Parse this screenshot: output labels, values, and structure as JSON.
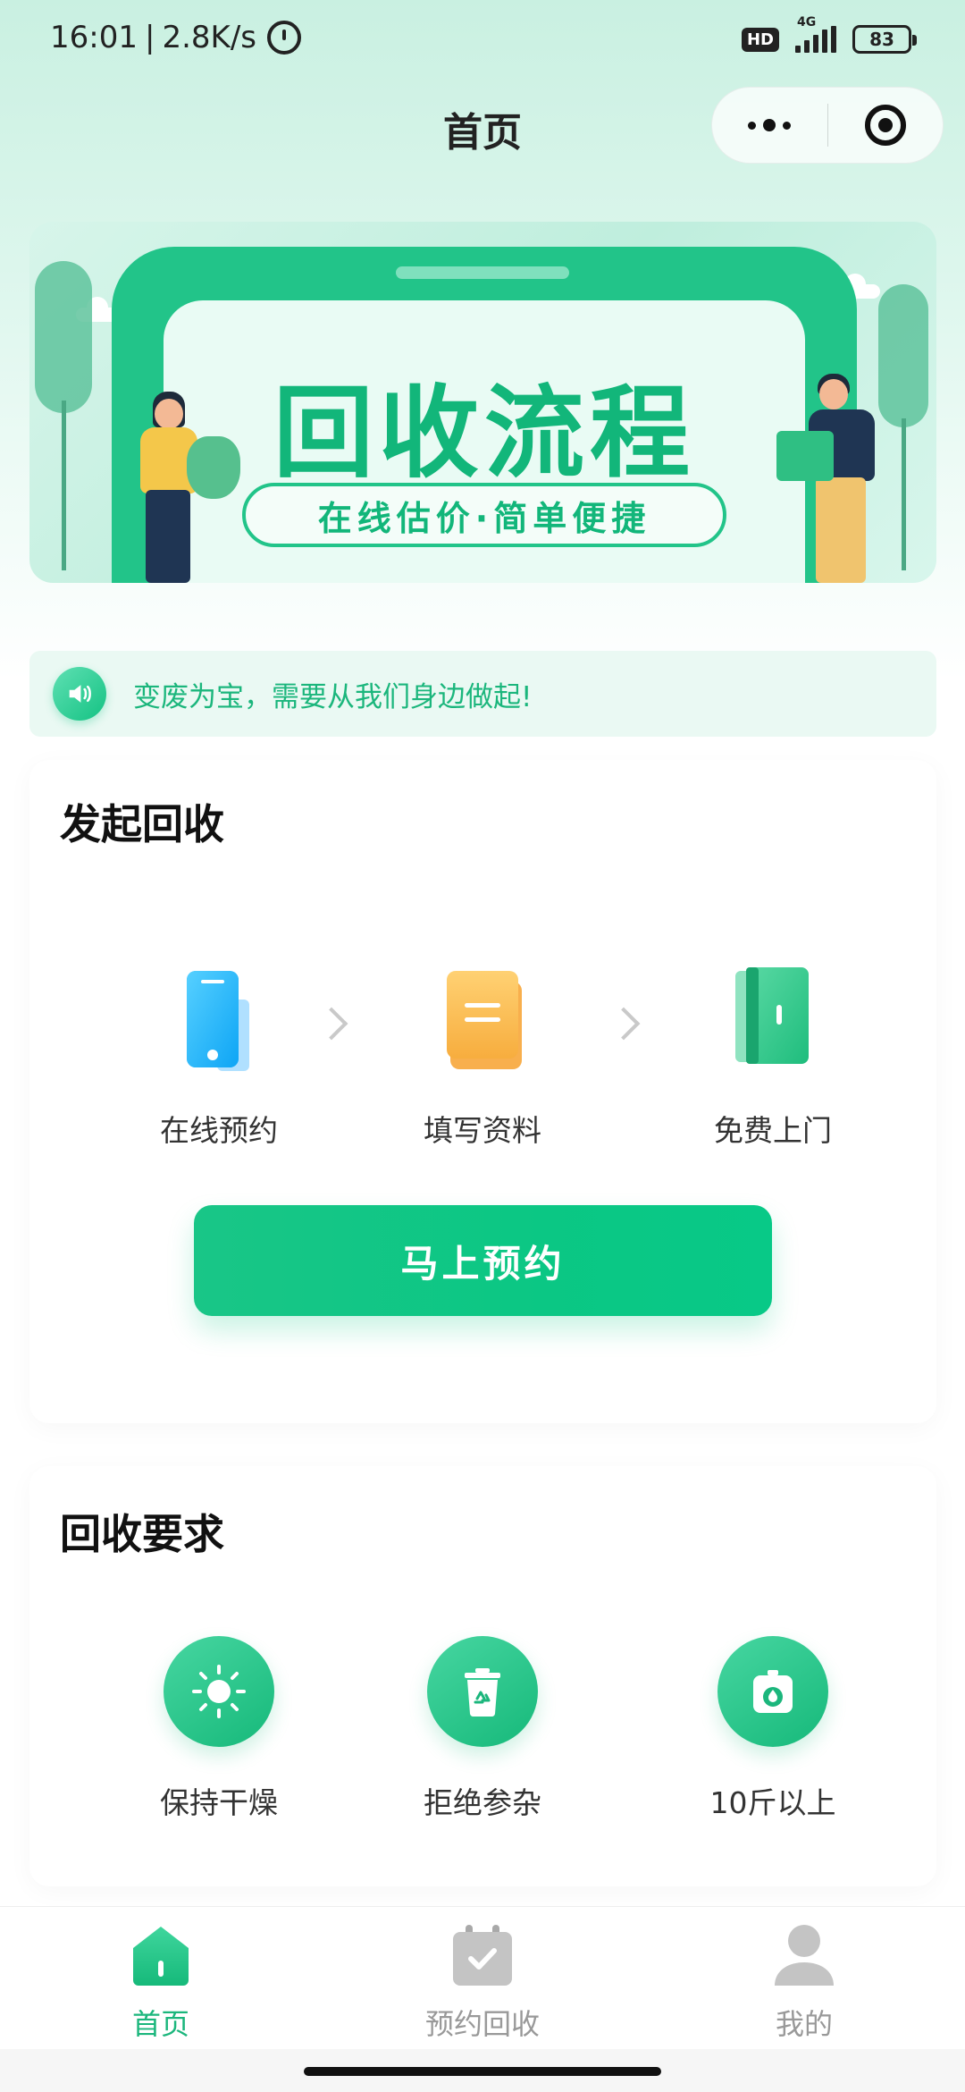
{
  "status_bar": {
    "time": "16:01",
    "speed": "2.8K/s",
    "hd": "HD",
    "network": "4G",
    "battery": "83"
  },
  "nav": {
    "title": "首页"
  },
  "banner": {
    "title": "回收流程",
    "subtitle": "在线估价·简单便捷"
  },
  "notice": {
    "text": "变废为宝，需要从我们身边做起!"
  },
  "start_recycle": {
    "title": "发起回收",
    "steps": [
      {
        "label": "在线预约",
        "icon": "phone-icon"
      },
      {
        "label": "填写资料",
        "icon": "form-icon"
      },
      {
        "label": "免费上门",
        "icon": "door-icon"
      }
    ],
    "button_label": "马上预约"
  },
  "requirements": {
    "title": "回收要求",
    "items": [
      {
        "label": "保持干燥",
        "icon": "sun-icon"
      },
      {
        "label": "拒绝参杂",
        "icon": "recycle-bin-icon"
      },
      {
        "label": "10斤以上",
        "icon": "scale-icon"
      }
    ]
  },
  "tabbar": {
    "items": [
      {
        "label": "首页",
        "icon": "home-icon",
        "active": true
      },
      {
        "label": "预约回收",
        "icon": "calendar-check-icon",
        "active": false
      },
      {
        "label": "我的",
        "icon": "user-icon",
        "active": false
      }
    ]
  },
  "colors": {
    "primary": "#14c283",
    "accent_text": "#1bb67c",
    "header_bg": "#c9f0e1",
    "inactive": "#999999"
  }
}
